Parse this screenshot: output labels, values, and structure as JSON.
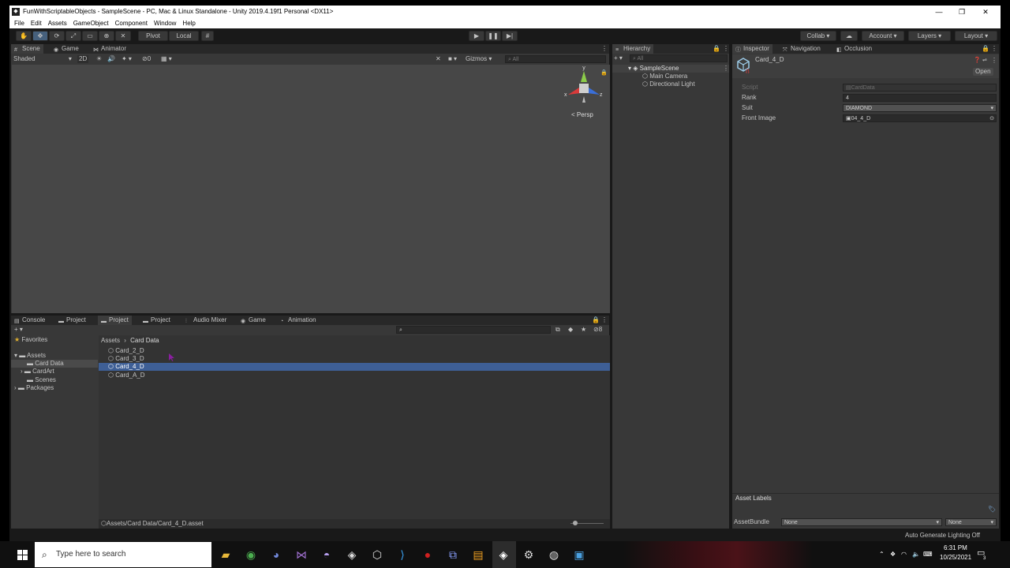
{
  "window": {
    "title": "FunWithScriptableObjects - SampleScene - PC, Mac & Linux Standalone - Unity 2019.4.19f1 Personal <DX11>",
    "controls": [
      "—",
      "❐",
      "✕"
    ]
  },
  "menu": [
    "File",
    "Edit",
    "Assets",
    "GameObject",
    "Component",
    "Window",
    "Help"
  ],
  "toolbar": {
    "pivot": "Pivot",
    "local": "Local",
    "collab": "Collab ▾",
    "account": "Account",
    "layers": "Layers",
    "layout": "Layout"
  },
  "scene": {
    "tabs": [
      "Scene",
      "Game",
      "Animator"
    ],
    "shading": "Shaded",
    "mode2d": "2D",
    "gizmos": "Gizmos",
    "search_placeholder": "All",
    "persp": "Persp",
    "axes": {
      "x": "x",
      "y": "y",
      "z": "z"
    },
    "fx_count": "0"
  },
  "hierarchy": {
    "title": "Hierarchy",
    "search_placeholder": "All",
    "scene": "SampleScene",
    "items": [
      "Main Camera",
      "Directional Light"
    ]
  },
  "inspector": {
    "tabs": [
      "Inspector",
      "Navigation",
      "Occlusion"
    ],
    "asset_name": "Card_4_D",
    "open_label": "Open",
    "fields": [
      {
        "label": "Script",
        "value": "CardData"
      },
      {
        "label": "Rank",
        "value": "4"
      },
      {
        "label": "Suit",
        "value": "DIAMOND"
      },
      {
        "label": "Front Image",
        "value": "04_4_D"
      }
    ],
    "asset_labels": "Asset Labels",
    "assetbundle_label": "AssetBundle",
    "assetbundle_value": "None",
    "assetbundle_variant": "None"
  },
  "project": {
    "tabs": [
      "Console",
      "Project",
      "Project",
      "Project",
      "Audio Mixer",
      "Game",
      "Animation"
    ],
    "tree": {
      "favorites": "Favorites",
      "assets": "Assets",
      "folders": [
        "Card Data",
        "CardArt",
        "Scenes"
      ],
      "packages": "Packages"
    },
    "breadcrumb": [
      "Assets",
      "Card Data"
    ],
    "files": [
      "Card_2_D",
      "Card_3_D",
      "Card_4_D",
      "Card_A_D"
    ],
    "selected_index": 2,
    "status_path": "Assets/Card Data/Card_4_D.asset",
    "hidden_count": "8"
  },
  "statusbar": {
    "lighting": "Auto Generate Lighting Off"
  },
  "taskbar": {
    "search_placeholder": "Type here to search",
    "time": "6:31 PM",
    "date": "10/25/2021",
    "notifications": "3"
  },
  "colors": {
    "selection": "#3e5f96",
    "panel": "#383838",
    "sceneview": "#474747",
    "axis_x": "#d93a3a",
    "axis_y": "#8ccc4a",
    "axis_z": "#3a6fd9"
  }
}
